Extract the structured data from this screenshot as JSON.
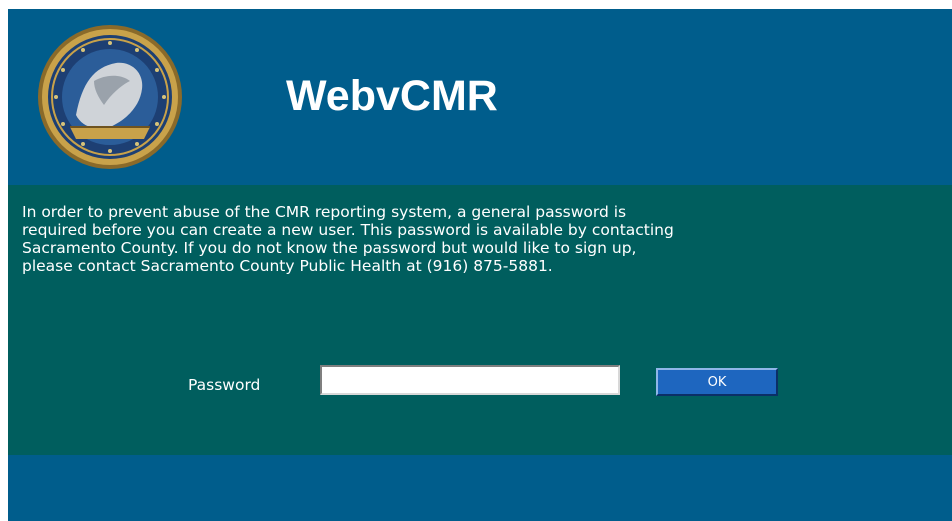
{
  "header": {
    "title": "WebvCMR",
    "logo_icon": "county-seal-icon"
  },
  "main": {
    "notice_lines": [
      "In order to prevent abuse of the CMR reporting system, a general password is",
      "required before you can create a new user.  This password is available by contacting",
      "Sacramento County. If you do not know the password but would like to sign up,",
      "please contact Sacramento County Public Health at (916) 875-5881."
    ],
    "password_label": "Password",
    "password_value": "",
    "ok_label": "OK"
  },
  "colors": {
    "header_bg": "#005d8c",
    "main_bg": "#005e5e",
    "button_bg": "#1e66bf",
    "text": "#ffffff"
  }
}
